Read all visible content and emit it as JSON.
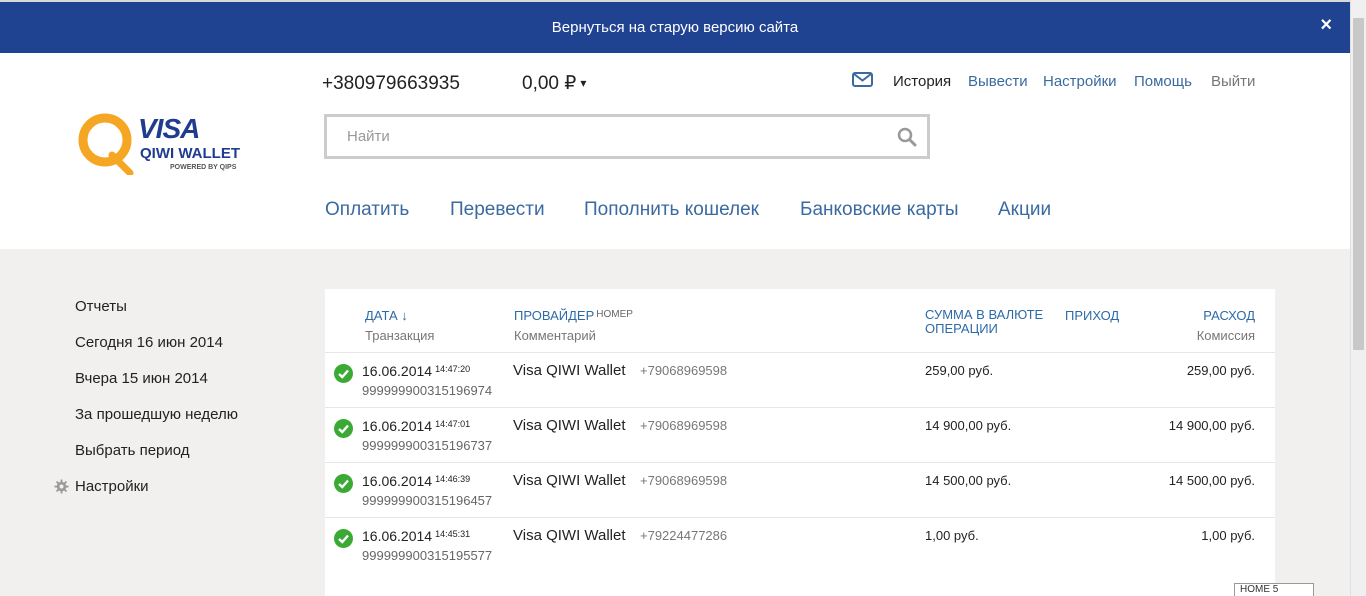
{
  "topbar": {
    "text": "Вернуться на старую версию сайта",
    "close": "×"
  },
  "logo": {
    "visa": "VISA",
    "wallet": "QIWI WALLET",
    "powered": "POWERED BY QIPS"
  },
  "account": {
    "phone": "+380979663935",
    "balance": "0,00 ₽",
    "balance_caret": "▾"
  },
  "toplinks": {
    "history": "История",
    "withdraw": "Вывести",
    "settings": "Настройки",
    "help": "Помощь",
    "logout": "Выйти"
  },
  "search": {
    "placeholder": "Найти"
  },
  "mainnav": {
    "pay": "Оплатить",
    "transfer": "Перевести",
    "topup": "Пополнить кошелек",
    "cards": "Банковские карты",
    "promo": "Акции"
  },
  "sidebar": {
    "items": [
      "Отчеты",
      "Сегодня 16 июн 2014",
      "Вчера 15 июн 2014",
      "За прошедшую неделю",
      "Выбрать период",
      "Настройки"
    ]
  },
  "table": {
    "headers": {
      "date": "ДАТА ↓",
      "date_sub": "Транзакция",
      "provider": "ПРОВАЙДЕР",
      "provider_small": "НОМЕР",
      "provider_sub": "Комментарий",
      "sum_line1": "СУММА В ВАЛЮТЕ",
      "sum_line2": "ОПЕРАЦИИ",
      "income": "ПРИХОД",
      "expense": "РАСХОД",
      "expense_sub": "Комиссия"
    },
    "rows": [
      {
        "date": "16.06.2014",
        "time": "14:47:20",
        "txn": "999999900315196974",
        "provider": "Visa QIWI Wallet",
        "number": "+79068969598",
        "sum": "259,00 руб.",
        "expense": "259,00 руб."
      },
      {
        "date": "16.06.2014",
        "time": "14:47:01",
        "txn": "999999900315196737",
        "provider": "Visa QIWI Wallet",
        "number": "+79068969598",
        "sum": "14 900,00 руб.",
        "expense": "14 900,00 руб."
      },
      {
        "date": "16.06.2014",
        "time": "14:46:39",
        "txn": "999999900315196457",
        "provider": "Visa QIWI Wallet",
        "number": "+79068969598",
        "sum": "14 500,00 руб.",
        "expense": "14 500,00 руб."
      },
      {
        "date": "16.06.2014",
        "time": "14:45:31",
        "txn": "999999900315195577",
        "provider": "Visa QIWI Wallet",
        "number": "+79224477286",
        "sum": "1,00 руб.",
        "expense": "1,00 руб."
      }
    ]
  },
  "badge": {
    "text": "HOME 5"
  },
  "colors": {
    "topbar": "#1f4391",
    "link": "#3b6aa0",
    "success": "#3aaa35",
    "logo_orange": "#f5a623",
    "logo_blue": "#1f3c8f"
  }
}
